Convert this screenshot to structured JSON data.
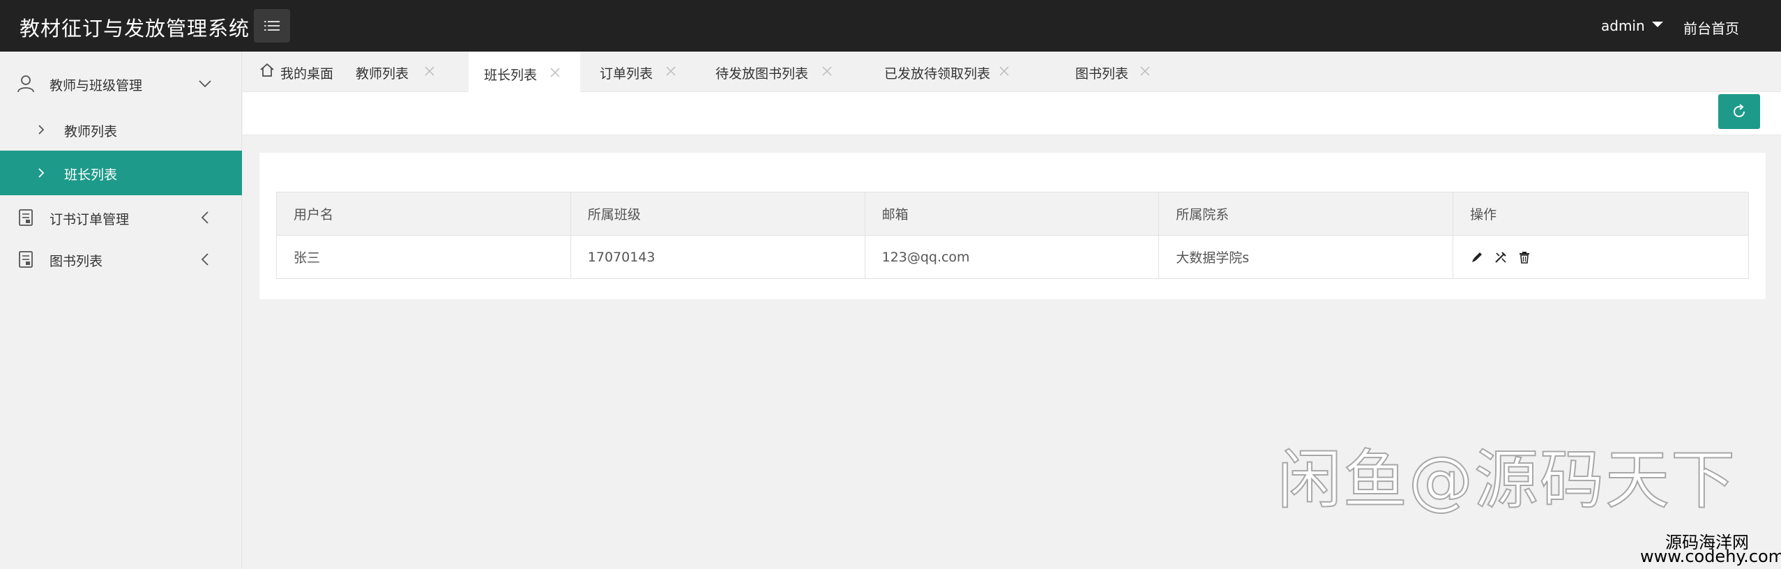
{
  "header": {
    "app_title": "教材征订与发放管理系统",
    "menu_toggle_icon": "list-icon",
    "user": "admin",
    "home_link": "前台首页"
  },
  "sidebar": {
    "groups": [
      {
        "label": "教师与班级管理",
        "icon": "user-icon",
        "expanded": true,
        "items": [
          {
            "label": "教师列表",
            "active": false
          },
          {
            "label": "班长列表",
            "active": true
          }
        ]
      },
      {
        "label": "订书订单管理",
        "icon": "document-icon",
        "expanded": false
      },
      {
        "label": "图书列表",
        "icon": "document-icon",
        "expanded": false
      }
    ]
  },
  "tabs": [
    {
      "label": "我的桌面",
      "icon": "home-icon",
      "closable": false,
      "active": false
    },
    {
      "label": "教师列表",
      "closable": true,
      "active": false
    },
    {
      "label": "班长列表",
      "closable": true,
      "active": true
    },
    {
      "label": "订单列表",
      "closable": true,
      "active": false
    },
    {
      "label": "待发放图书列表",
      "closable": true,
      "active": false
    },
    {
      "label": "已发放待领取列表",
      "closable": true,
      "active": false
    },
    {
      "label": "图书列表",
      "closable": true,
      "active": false
    }
  ],
  "toolbar": {
    "refresh_icon": "refresh-icon"
  },
  "table": {
    "columns": [
      "用户名",
      "所属班级",
      "邮箱",
      "所属院系",
      "操作"
    ],
    "rows": [
      {
        "username": "张三",
        "class": "17070143",
        "email": "123@qq.com",
        "department": "大数据学院s",
        "actions": [
          "edit-icon",
          "reset-icon",
          "delete-icon"
        ]
      }
    ]
  },
  "watermark": {
    "main": "闲鱼@源码天下",
    "line1": "源码海洋网",
    "line2": "www.codehy.com"
  },
  "colors": {
    "header_bg": "#222222",
    "accent": "#1e9a8a",
    "page_bg": "#f1f1f1"
  }
}
